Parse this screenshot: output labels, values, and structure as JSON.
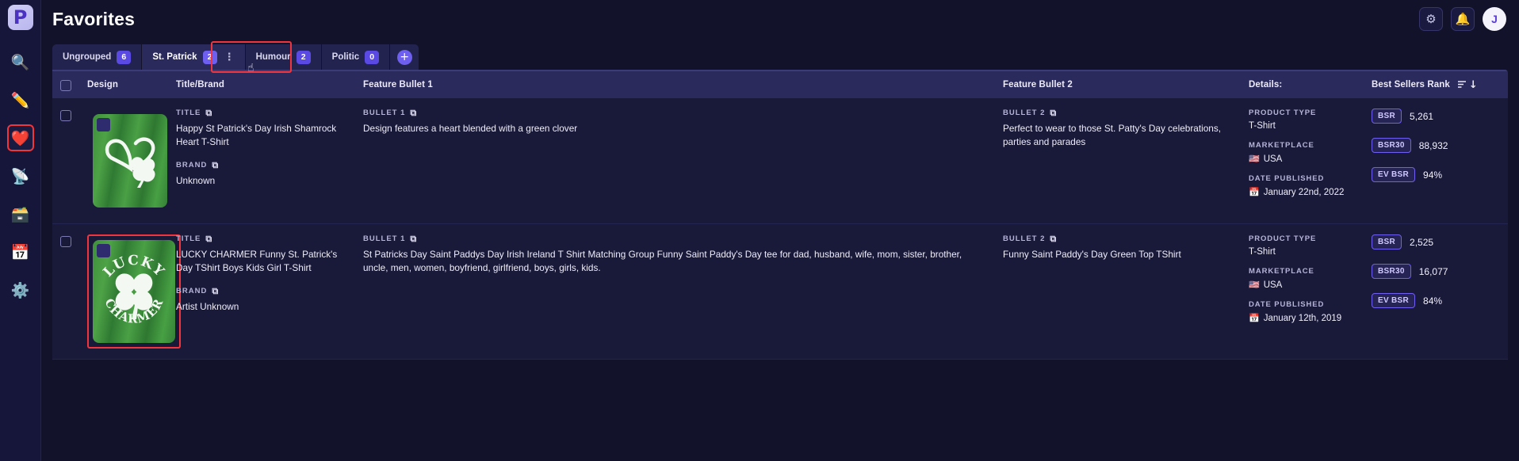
{
  "app": {
    "logo_letter": "P",
    "title": "Favorites"
  },
  "sidebar": {
    "items": [
      {
        "name": "search",
        "glyph": "🔍"
      },
      {
        "name": "pencil",
        "glyph": "✏️"
      },
      {
        "name": "favorites",
        "glyph": "❤️"
      },
      {
        "name": "satellite",
        "glyph": "📡"
      },
      {
        "name": "card-box",
        "glyph": "🗃️"
      },
      {
        "name": "calendar",
        "glyph": "📅"
      },
      {
        "name": "settings",
        "glyph": "⚙️"
      }
    ]
  },
  "topbar": {
    "settings_icon": "⚙",
    "notifications_icon": "🔔",
    "avatar_initial": "J"
  },
  "tabs": {
    "items": [
      {
        "label": "Ungrouped",
        "count": "6",
        "selected": false,
        "kebab": ""
      },
      {
        "label": "St. Patrick",
        "count": "2",
        "selected": true,
        "kebab": "⋮"
      },
      {
        "label": "Humour",
        "count": "2",
        "selected": false,
        "kebab": ""
      },
      {
        "label": "Politic",
        "count": "0",
        "selected": false,
        "kebab": ""
      }
    ],
    "add_label": "+"
  },
  "table": {
    "headers": {
      "design": "Design",
      "title_brand": "Title/Brand",
      "feature_bullet_1": "Feature Bullet 1",
      "feature_bullet_2": "Feature Bullet 2",
      "details": "Details:",
      "best_sellers_rank": "Best Sellers Rank",
      "sort_icon": "↓"
    },
    "labels": {
      "title": "TITLE",
      "brand": "BRAND",
      "bullet1": "BULLET 1",
      "bullet2": "BULLET 2",
      "product_type": "PRODUCT TYPE",
      "marketplace": "MARKETPLACE",
      "date_published": "DATE PUBLISHED",
      "copy_icon": "⧉",
      "flag_icon": "🇺🇸",
      "calendar_icon": "📅"
    },
    "rows": [
      {
        "design_art": "heart-clover",
        "design_highlighted": false,
        "title": "Happy St Patrick's Day Irish Shamrock Heart T-Shirt",
        "brand": "Unknown",
        "bullet1": "Design features a heart blended with a green clover",
        "bullet2": "Perfect to wear to those St. Patty's Day celebrations, parties and parades",
        "product_type": "T-Shirt",
        "marketplace": "USA",
        "date_published": "January 22nd, 2022",
        "badges": [
          {
            "label": "BSR",
            "value": "5,261"
          },
          {
            "label": "BSR30",
            "value": "88,932"
          },
          {
            "label": "EV BSR",
            "value": "94%"
          }
        ]
      },
      {
        "design_art": "lucky-charmer",
        "design_highlighted": true,
        "design_text_top": "LUCKY",
        "design_text_bottom": "CHARMER",
        "title": "LUCKY CHARMER Funny St. Patrick's Day TShirt Boys Kids Girl T-Shirt",
        "brand": "Artist Unknown",
        "bullet1": "St Patricks Day Saint Paddys Day Irish Ireland T Shirt Matching Group Funny Saint Paddy's Day tee for dad, husband, wife, mom, sister, brother, uncle, men, women, boyfriend, girlfriend, boys, girls, kids.",
        "bullet2": "Funny Saint Paddy's Day Green Top TShirt",
        "product_type": "T-Shirt",
        "marketplace": "USA",
        "date_published": "January 12th, 2019",
        "badges": [
          {
            "label": "BSR",
            "value": "2,525"
          },
          {
            "label": "BSR30",
            "value": "16,077"
          },
          {
            "label": "EV BSR",
            "value": "84%"
          }
        ]
      }
    ]
  },
  "colors": {
    "accent": "#6f5ff0",
    "highlight": "#f2353c",
    "header_bg": "#2a2a5c",
    "page_bg": "#12122b"
  }
}
